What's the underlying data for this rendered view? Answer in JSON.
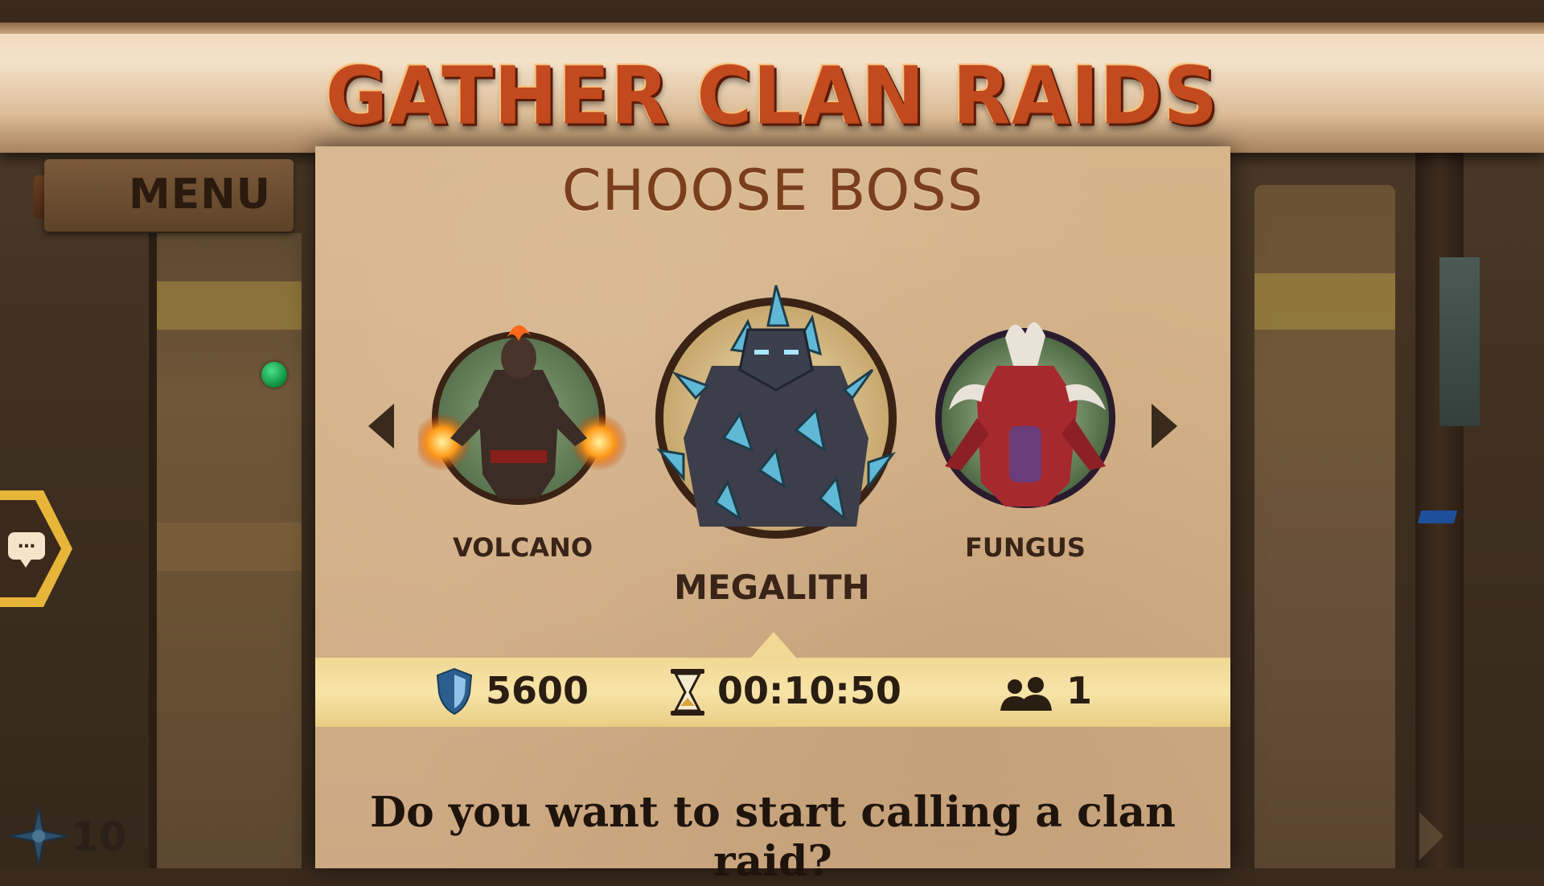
{
  "header": {
    "title": "GATHER CLAN RAIDS"
  },
  "menu": {
    "label": "MENU"
  },
  "panel": {
    "title": "CHOOSE BOSS",
    "bosses": [
      {
        "name": "VOLCANO",
        "state": "side"
      },
      {
        "name": "MEGALITH",
        "state": "selected"
      },
      {
        "name": "FUNGUS",
        "state": "side"
      }
    ],
    "stats": {
      "power": "5600",
      "timer": "00:10:50",
      "players": "1"
    },
    "prompt": "Do you want to start calling a clan raid?"
  },
  "hud": {
    "counter": "10"
  },
  "icons": [
    "chevron-left-icon",
    "chevron-right-icon",
    "shield-icon",
    "hourglass-icon",
    "players-icon",
    "chat-icon",
    "crosshair-icon"
  ],
  "colors": {
    "title": "#c24a1e",
    "parchment": "#d6b58b",
    "stats_strip": "#f1d894",
    "chat_badge": "#e7b53a"
  }
}
